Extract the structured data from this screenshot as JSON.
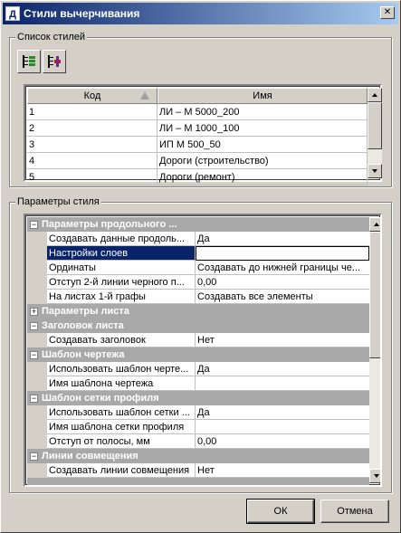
{
  "window": {
    "title": "Стили вычерчивания",
    "icon_letter": "Д",
    "close_glyph": "✕"
  },
  "styles_group": {
    "label": "Список стилей",
    "toolbar": [
      {
        "icon": "add-style-icon"
      },
      {
        "icon": "delete-style-icon"
      }
    ],
    "columns": {
      "code": "Код",
      "name": "Имя"
    },
    "rows": [
      {
        "code": "1",
        "name": "ЛИ – М 5000_200"
      },
      {
        "code": "2",
        "name": "ЛИ – М 1000_100"
      },
      {
        "code": "3",
        "name": "ИП М 500_50"
      },
      {
        "code": "4",
        "name": "Дороги (строительство)"
      },
      {
        "code": "5",
        "name": "Дороги (ремонт)"
      }
    ]
  },
  "params_group": {
    "label": "Параметры стиля",
    "rows": [
      {
        "type": "category",
        "expander": "−",
        "label": "Параметры продольного ..."
      },
      {
        "type": "prop",
        "name": "Создавать данные продоль...",
        "value": "Да"
      },
      {
        "type": "prop",
        "name": "Настройки слоев",
        "value": "",
        "selected": true
      },
      {
        "type": "prop",
        "name": "Ординаты",
        "value": "Создавать до нижней границы че..."
      },
      {
        "type": "prop",
        "name": "Отступ 2-й линии черного п...",
        "value": "0,00"
      },
      {
        "type": "prop",
        "name": "На листах 1-й графы",
        "value": "Создавать все элементы"
      },
      {
        "type": "category",
        "expander": "+",
        "label": "Параметры листа"
      },
      {
        "type": "category",
        "expander": "−",
        "label": "Заголовок листа"
      },
      {
        "type": "prop",
        "name": "Создавать заголовок",
        "value": "Нет"
      },
      {
        "type": "category",
        "expander": "−",
        "label": "Шаблон чертежа"
      },
      {
        "type": "prop",
        "name": "Использовать шаблон черте...",
        "value": "Да"
      },
      {
        "type": "prop",
        "name": "Имя шаблона чертежа",
        "value": ""
      },
      {
        "type": "category",
        "expander": "−",
        "label": "Шаблон сетки профиля"
      },
      {
        "type": "prop",
        "name": "Использовать шаблон сетки ...",
        "value": "Да"
      },
      {
        "type": "prop",
        "name": "Имя шаблона сетки профиля",
        "value": ""
      },
      {
        "type": "prop",
        "name": "Отступ от полосы, мм",
        "value": "0,00"
      },
      {
        "type": "category",
        "expander": "−",
        "label": "Линии совмещения"
      },
      {
        "type": "prop",
        "name": "Создавать линии совмещения",
        "value": "Нет"
      }
    ]
  },
  "buttons": {
    "ok": "ОК",
    "cancel": "Отмена"
  },
  "colors": {
    "title_start": "#0a246a",
    "title_end": "#a6caf0",
    "category_bg": "#a8a8a8",
    "selection": "#0a246a"
  }
}
